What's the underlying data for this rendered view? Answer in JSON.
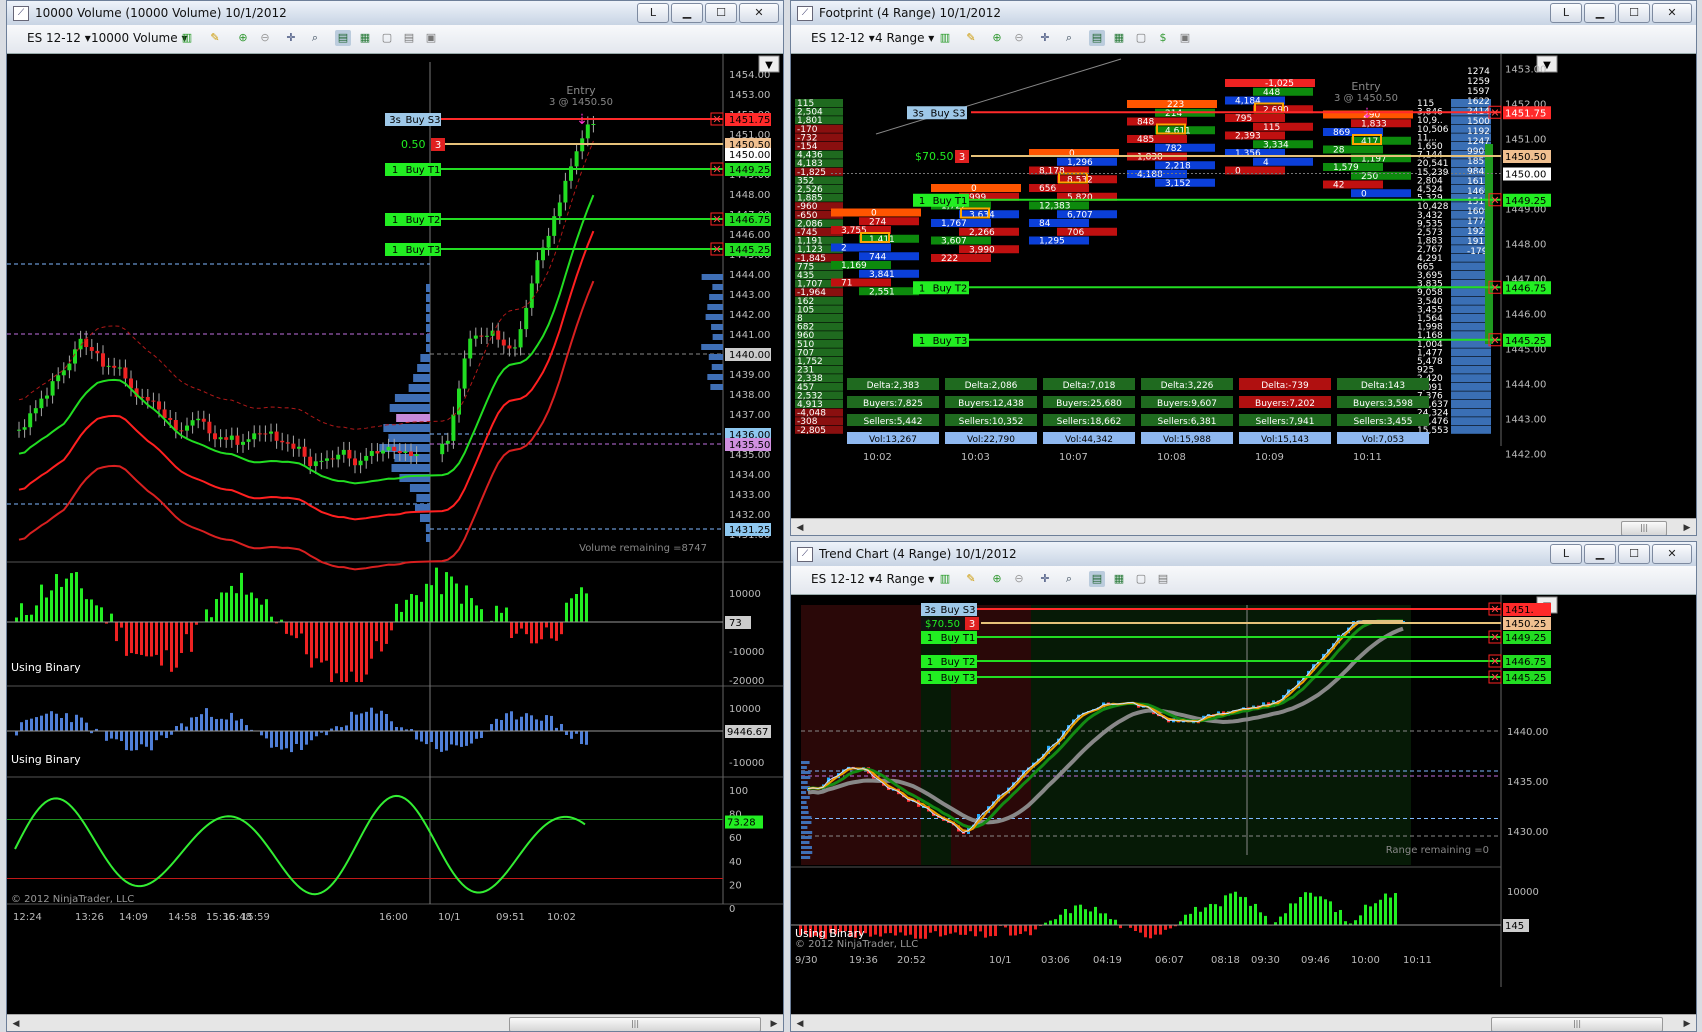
{
  "left_window": {
    "title": "10000 Volume (10000 Volume)  10/1/2012",
    "instrument": "ES 12-12",
    "period": "10000 Volume",
    "entry_label": "Entry",
    "entry_detail": "3 @ 1450.50",
    "orders": [
      {
        "label1": "3s",
        "label2": "Buy S3",
        "price": "1451.75",
        "color": "#ff2a2a"
      },
      {
        "label1": "1",
        "label2": "Buy T1",
        "price": "1449.25",
        "color": "#22dd22"
      },
      {
        "label1": "1",
        "label2": "Buy T2",
        "price": "1446.75",
        "color": "#22dd22"
      },
      {
        "label1": "1",
        "label2": "Buy T3",
        "price": "1445.25",
        "color": "#22dd22"
      }
    ],
    "position_label": "0.50",
    "position_qty": "3",
    "price_axis": [
      "1454.00",
      "1453.00",
      "1452.00",
      "1451.00",
      "1450.00",
      "1449.00",
      "1448.00",
      "1447.00",
      "1446.00",
      "1445.00",
      "1444.00",
      "1443.00",
      "1442.00",
      "1441.00",
      "1440.00",
      "1439.00",
      "1438.00",
      "1437.00",
      "1436.00",
      "1435.00",
      "1434.00",
      "1433.00",
      "1432.00",
      "1431.00"
    ],
    "price_flags": [
      "1450.50",
      "1450.00",
      "1440.00",
      "1436.00",
      "1435.50",
      "1431.25"
    ],
    "volume_remaining": "Volume remaining =8747",
    "panel1": {
      "label": "Using Binary",
      "axis": [
        "10000",
        "-10000",
        "-20000"
      ],
      "value": "73"
    },
    "panel2": {
      "label": "Using Binary",
      "axis": [
        "10000",
        "0",
        "-10000"
      ],
      "value": "9446.67"
    },
    "panel3": {
      "axis": [
        "100",
        "80",
        "60",
        "40",
        "20",
        "0"
      ],
      "value": "73.28"
    },
    "copyright": "© 2012 NinjaTrader, LLC",
    "time_axis": [
      "12:24",
      "13:26",
      "14:09",
      "14:58",
      "15:36",
      "15:48",
      "15:59",
      "16:00",
      "10/1",
      "09:51",
      "10:02"
    ]
  },
  "footprint_window": {
    "title": "Footprint (4 Range)  10/1/2012",
    "instrument": "ES 12-12",
    "period": "4 Range",
    "entry_label": "Entry",
    "entry_detail": "3 @ 1450.50",
    "order_top": {
      "label1": "3s",
      "label2": "Buy S3",
      "price": "1451.75"
    },
    "position": {
      "label": "$70.50",
      "qty": "3",
      "price": "1450.50"
    },
    "targets": [
      {
        "label1": "1",
        "label2": "Buy T1",
        "price": "1449.25"
      },
      {
        "label1": "1",
        "label2": "Buy T2",
        "price": "1446.75"
      },
      {
        "label1": "1",
        "label2": "Buy T3",
        "price": "1445.25"
      }
    ],
    "price_axis": [
      "1453.00",
      "1452.00",
      "1451.00",
      "1450.00",
      "1449.00",
      "1448.00",
      "1447.00",
      "1446.00",
      "1445.00",
      "1444.00",
      "1443.00",
      "1442.00"
    ],
    "price_flag_1450": "1450.00",
    "left_column": [
      "115",
      "2,504",
      "1,801",
      "-170",
      "-732",
      "-154",
      "4,436",
      "4,183",
      "-1,825",
      "352",
      "2,526",
      "1,885",
      "-960",
      "-650",
      "2,086",
      "-745",
      "1,191",
      "1,123",
      "-1,845",
      "775",
      "435",
      "1,707",
      "-1,964",
      "162",
      "105",
      "8",
      "682",
      "960",
      "510",
      "707",
      "1,752",
      "231",
      "2,338",
      "457",
      "2,532",
      "4,913",
      "-4,048",
      "-308",
      "-2,805"
    ],
    "right_volume_column": [
      "115",
      "3,846",
      "10,9..",
      "10,506",
      "11,..",
      "1,650",
      "7,144",
      "20,541",
      "15,239",
      "2,804",
      "4,524",
      "5,329",
      "10,428",
      "3,432",
      "9,535",
      "2,573",
      "1,883",
      "2,767",
      "4,291",
      "665",
      "3,695",
      "3,835",
      "9,058",
      "3,540",
      "3,455",
      "1,564",
      "1,998",
      "1,168",
      "1,004",
      "1,477",
      "5,478",
      "925",
      "2,420",
      "7,091",
      "7,376",
      "20,637",
      "24,324",
      "19,476",
      "15,553"
    ],
    "delta_column": [
      "1274",
      "1259",
      "1597",
      "1622",
      "2414",
      "1500",
      "1192",
      "1247",
      "990",
      "185",
      "984",
      "1615",
      "1469",
      "1519",
      "1609",
      "1774",
      "1925",
      "1917",
      "-1795"
    ],
    "summary": [
      {
        "delta": "Delta:2,383",
        "buyers": "Buyers:7,825",
        "sellers": "Sellers:5,442",
        "vol": "Vol:13,267",
        "neg": false
      },
      {
        "delta": "Delta:2,086",
        "buyers": "Buyers:12,438",
        "sellers": "Sellers:10,352",
        "vol": "Vol:22,790",
        "neg": false
      },
      {
        "delta": "Delta:7,018",
        "buyers": "Buyers:25,680",
        "sellers": "Sellers:18,662",
        "vol": "Vol:44,342",
        "neg": false
      },
      {
        "delta": "Delta:3,226",
        "buyers": "Buyers:9,607",
        "sellers": "Sellers:6,381",
        "vol": "Vol:15,988",
        "neg": false
      },
      {
        "delta": "Delta:-739",
        "buyers": "Buyers:7,202",
        "sellers": "Sellers:7,941",
        "vol": "Vol:15,143",
        "neg": true
      },
      {
        "delta": "Delta:143",
        "buyers": "Buyers:3,598",
        "sellers": "Sellers:3,455",
        "vol": "Vol:7,053",
        "neg": false
      }
    ],
    "bar_values": [
      {
        "cells": [
          "0",
          "274",
          "3,755",
          "1,411",
          "2",
          "744",
          "1,169",
          "3,841",
          "71",
          "2,551"
        ]
      },
      {
        "cells": [
          "0",
          "999",
          "1,722",
          "3,634",
          "1,767",
          "2,266",
          "3,607",
          "3,990",
          "222"
        ]
      },
      {
        "cells": [
          "0",
          "1,296",
          "8,178",
          "8,532",
          "656",
          "5,820",
          "12,383",
          "6,707",
          "84",
          "706",
          "1,295"
        ]
      },
      {
        "cells": [
          "223",
          "214",
          "848",
          "4,611",
          "485",
          "782",
          "1,838",
          "2,218",
          "4,188",
          "3,152"
        ]
      },
      {
        "cells": [
          "-1,025",
          "448",
          "4,184",
          "2,690",
          "795",
          "115",
          "2,393",
          "3,334",
          "1,356",
          "4",
          "0"
        ]
      },
      {
        "cells": [
          "290",
          "1,833",
          "869",
          "417",
          "28",
          "1,197",
          "1,579",
          "250",
          "42",
          "0"
        ]
      }
    ],
    "time_axis": [
      "10:02",
      "10:03",
      "10:07",
      "10:08",
      "10:09",
      "10:11"
    ]
  },
  "trend_window": {
    "title": "Trend Chart (4 Range)  10/1/2012",
    "instrument": "ES 12-12",
    "period": "4 Range",
    "orders": [
      {
        "label1": "3s",
        "label2": "Buy S3",
        "price": "1451.",
        "color": "#ff2a2a"
      },
      {
        "label1": "1",
        "label2": "Buy T1",
        "price": "1449.25",
        "color": "#22dd22"
      },
      {
        "label1": "1",
        "label2": "Buy T2",
        "price": "1446.75",
        "color": "#22dd22"
      },
      {
        "label1": "1",
        "label2": "Buy T3",
        "price": "1445.25",
        "color": "#22dd22"
      }
    ],
    "position": {
      "label": "$70.50",
      "qty": "3",
      "price": "1450.25"
    },
    "price_axis": [
      "1440.00",
      "1435.00",
      "1430.00"
    ],
    "range_remaining": "Range remaining =0",
    "lower_panel": {
      "label": "Using Binary",
      "axis": [
        "10000",
        "0"
      ],
      "value": "145"
    },
    "copyright": "© 2012 NinjaTrader, LLC",
    "time_axis": [
      "9/30",
      "19:36",
      "20:52",
      "10/1",
      "03:06",
      "04:19",
      "06:07",
      "08:18",
      "09:30",
      "09:46",
      "10:00",
      "10:11"
    ]
  },
  "colors": {
    "buy": "#22dd22",
    "sell": "#ee2222",
    "accent": "#4a86e8",
    "background": "#000000"
  }
}
